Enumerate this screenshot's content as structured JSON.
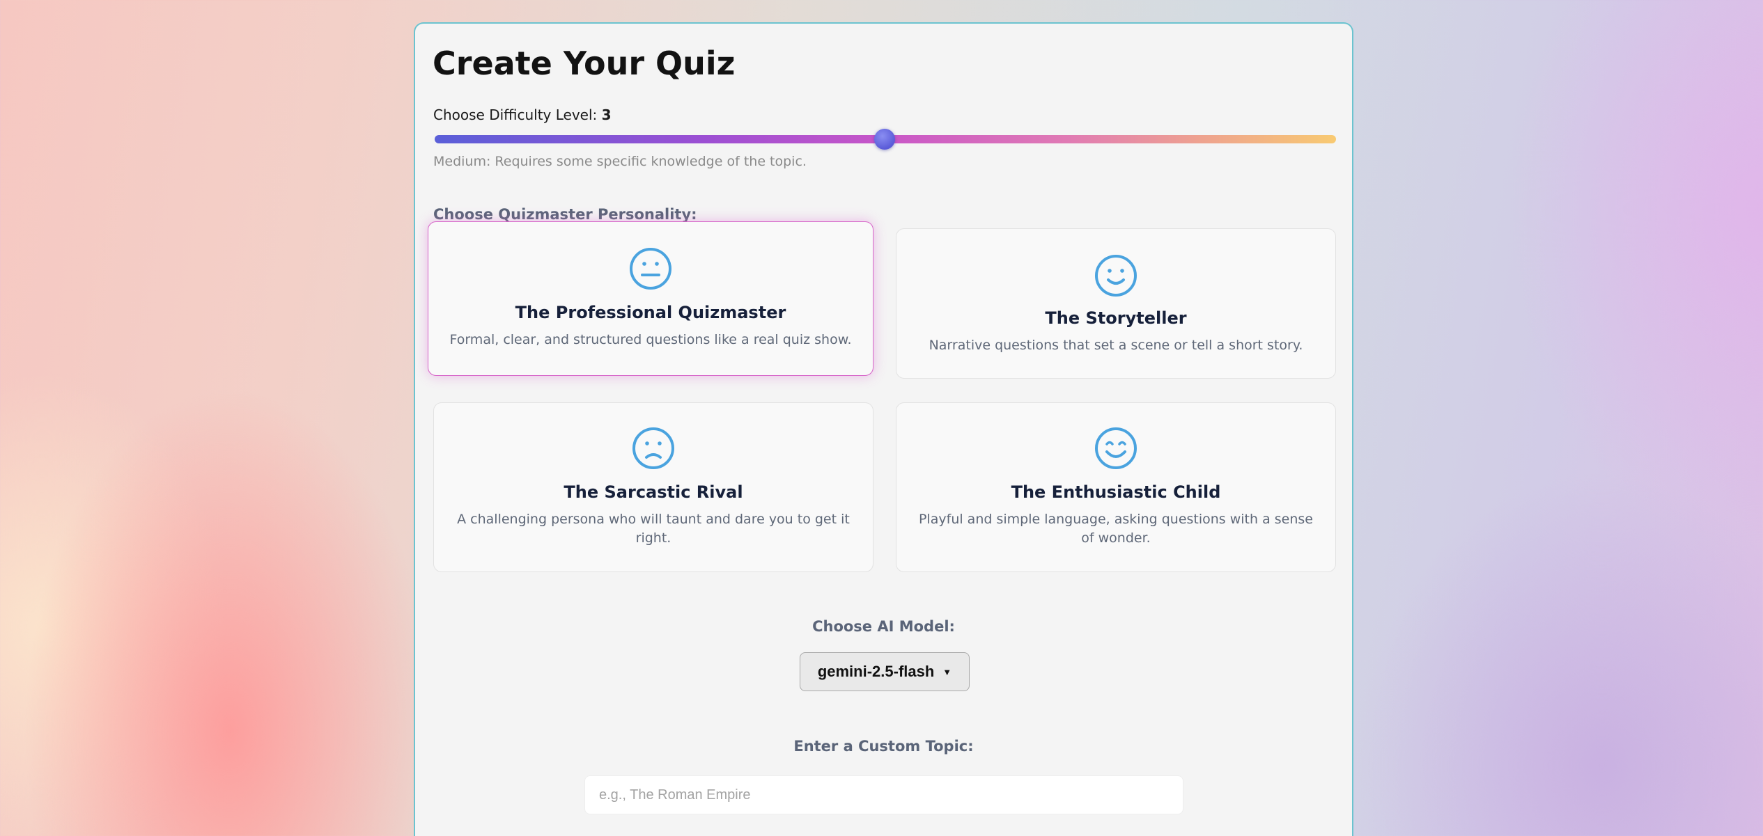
{
  "page": {
    "title": "Create Your Quiz"
  },
  "difficulty": {
    "label": "Choose Difficulty Level:",
    "value": "3",
    "level_fraction": 0.5,
    "description": "Medium: Requires some specific knowledge of the topic."
  },
  "personality": {
    "label": "Choose Quizmaster Personality:",
    "options": [
      {
        "title": "The Professional Quizmaster",
        "description": "Formal, clear, and structured questions like a real quiz show.",
        "icon": "neutral-face-icon",
        "selected": true
      },
      {
        "title": "The Storyteller",
        "description": "Narrative questions that set a scene or tell a short story.",
        "icon": "smile-face-icon",
        "selected": false
      },
      {
        "title": "The Sarcastic Rival",
        "description": "A challenging persona who will taunt and dare you to get it right.",
        "icon": "sad-face-icon",
        "selected": false
      },
      {
        "title": "The Enthusiastic Child",
        "description": "Playful and simple language, asking questions with a sense of wonder.",
        "icon": "happy-face-icon",
        "selected": false
      }
    ]
  },
  "model": {
    "label": "Choose AI Model:",
    "selected": "gemini-2.5-flash"
  },
  "topic": {
    "label": "Enter a Custom Topic:",
    "placeholder": "e.g., The Roman Empire",
    "value": ""
  },
  "colors": {
    "accent_icon": "#4aa3df",
    "selected_border": "#d663c8",
    "card_border": "#6bc3cf",
    "slider_start": "#5a5fd8",
    "slider_end": "#f8ca72"
  }
}
